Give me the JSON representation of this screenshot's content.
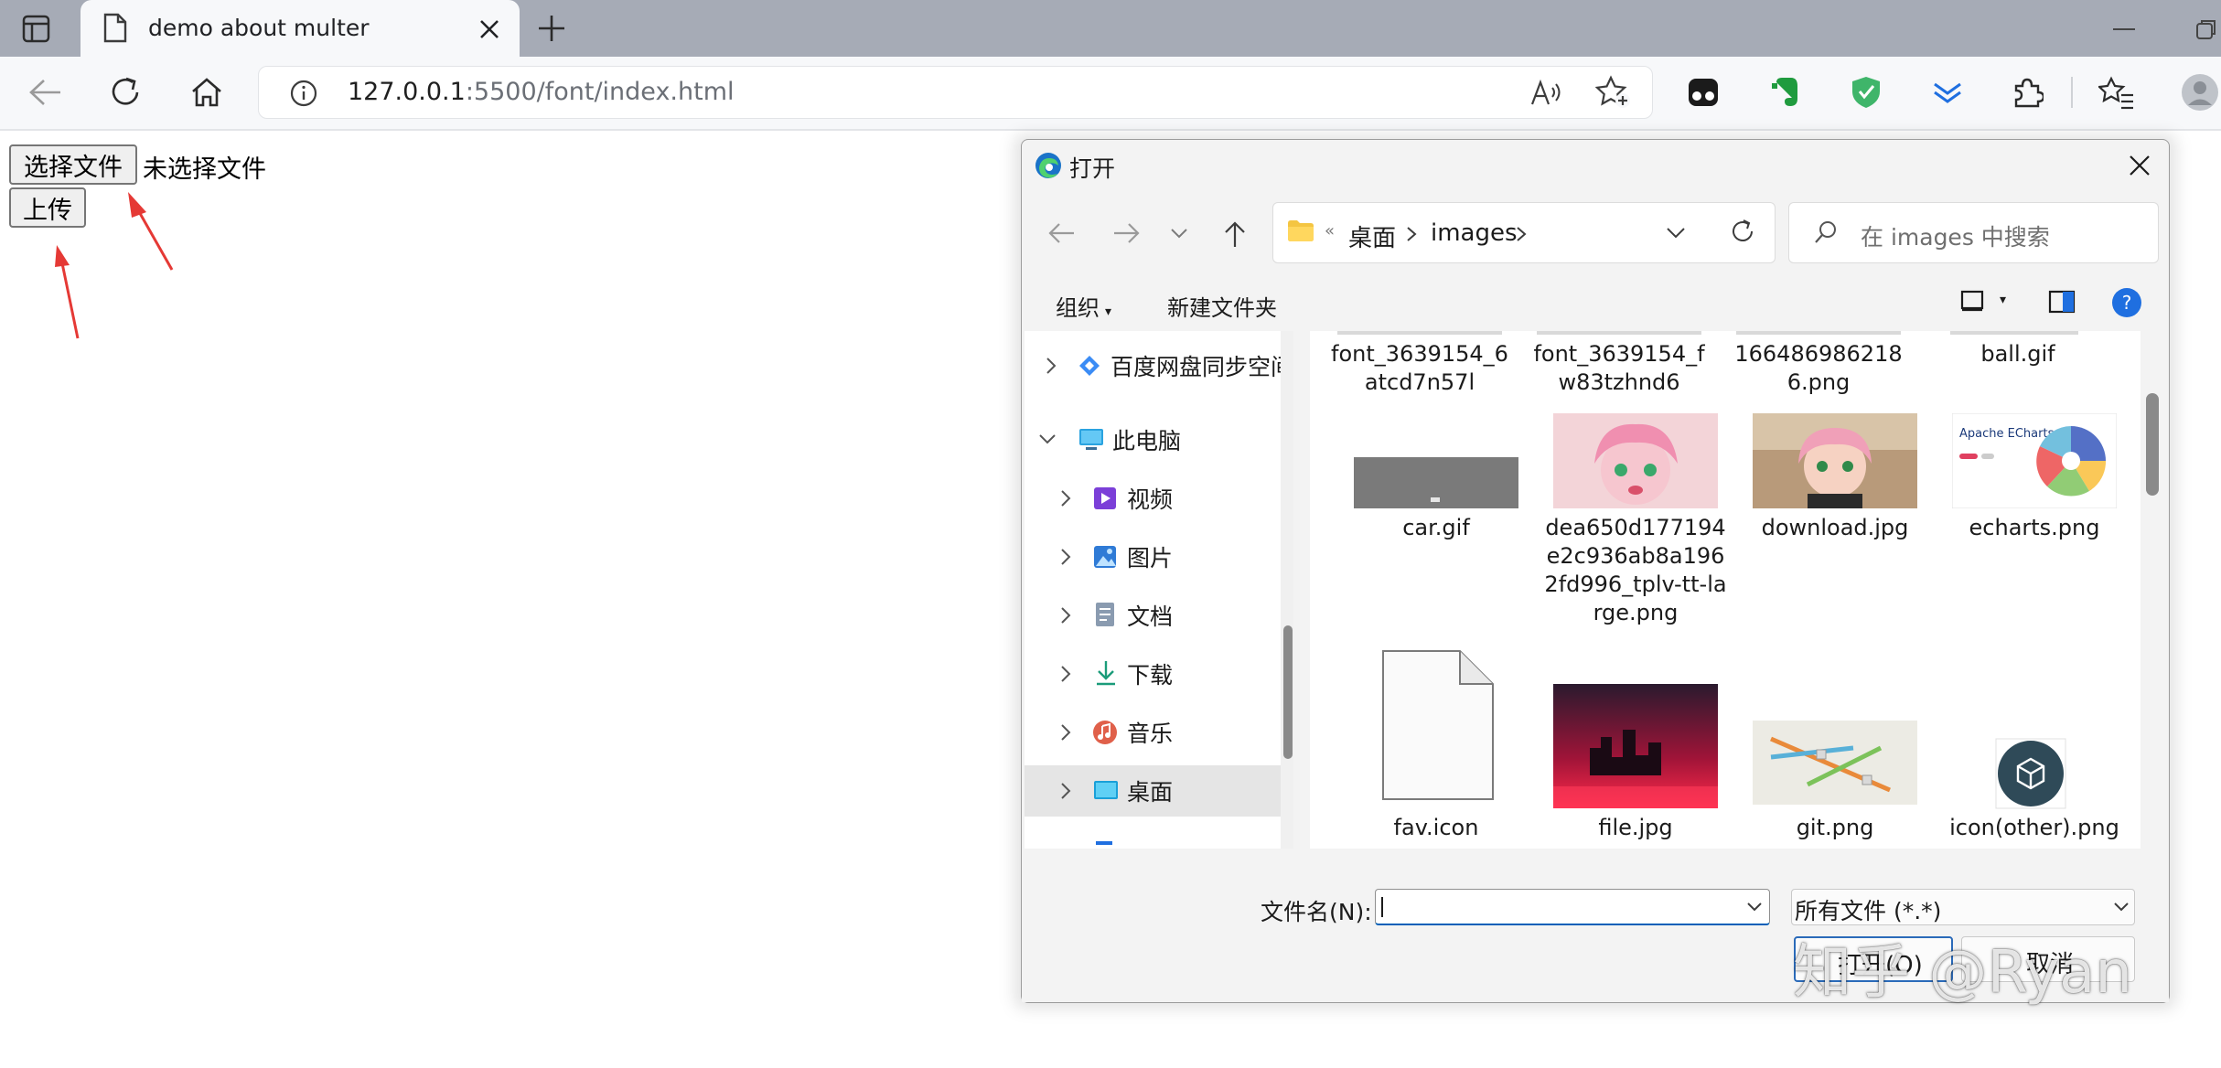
{
  "browser": {
    "tab_title": "demo about multer",
    "url_host": "127.0.0.1",
    "url_rest": ":5500/font/index.html"
  },
  "page": {
    "choose_button": "选择文件",
    "no_file_text": "未选择文件",
    "upload_button": "上传",
    "arrow_color": "#e53935"
  },
  "dialog": {
    "title": "打开",
    "breadcrumb": [
      "桌面",
      "images"
    ],
    "search_placeholder": "在 images 中搜索",
    "organize": "组织",
    "new_folder": "新建文件夹",
    "nav_items": [
      {
        "label": "百度网盘同步空间",
        "icon": "baidu-netdisk-icon",
        "expandable": true
      },
      {
        "label": "此电脑",
        "icon": "computer-icon",
        "expanded": true
      },
      {
        "label": "视频",
        "icon": "video-folder-icon",
        "expandable": true
      },
      {
        "label": "图片",
        "icon": "pictures-folder-icon",
        "expandable": true
      },
      {
        "label": "文档",
        "icon": "documents-folder-icon",
        "expandable": true
      },
      {
        "label": "下载",
        "icon": "downloads-folder-icon",
        "expandable": true
      },
      {
        "label": "音乐",
        "icon": "music-folder-icon",
        "expandable": true
      },
      {
        "label": "桌面",
        "icon": "desktop-folder-icon",
        "expandable": true,
        "selected": true
      }
    ],
    "files_row1": [
      "font_3639154_6atcd7n57l",
      "font_3639154_fw83tzhnd6",
      "1664869862186.png",
      "ball.gif"
    ],
    "files_row2": [
      "car.gif",
      "dea650d177194e2c936ab8a1962fd996_tplv-tt-large.png",
      "download.jpg",
      "echarts.png"
    ],
    "files_row3": [
      "fav.icon",
      "file.jpg",
      "git.png",
      "icon(other).png"
    ],
    "echarts_thumb_text": "Apache ECharts",
    "file_name_label": "文件名(N):",
    "file_name_value": "",
    "file_type_filter": "所有文件 (*.*)",
    "open_button": "打开(O)",
    "cancel_button": "取消"
  },
  "watermark": "知乎 @Ryan"
}
